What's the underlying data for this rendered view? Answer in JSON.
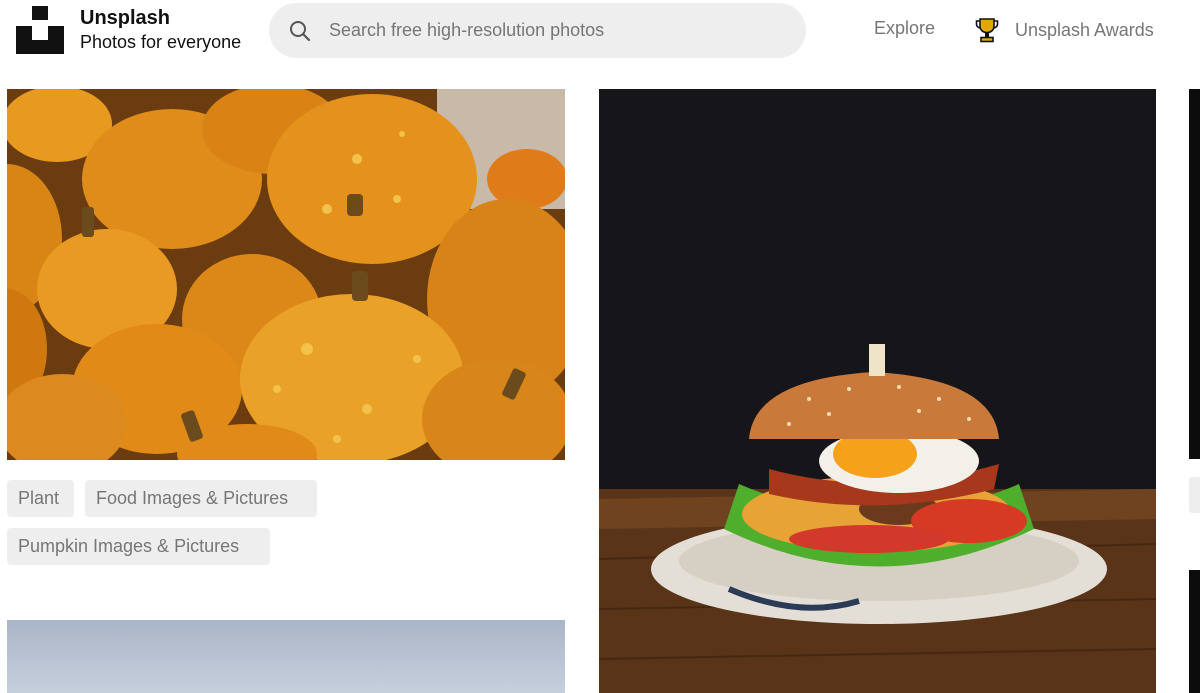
{
  "brand": {
    "name": "Unsplash",
    "tagline": "Photos for everyone"
  },
  "search": {
    "placeholder": "Search free high-resolution photos",
    "icon": "search-icon"
  },
  "nav": {
    "explore": "Explore",
    "awards": "Unsplash Awards",
    "awards_icon": "trophy-icon"
  },
  "photos": [
    {
      "subject": "pumpkins",
      "tags": [
        "Plant",
        "Food Images & Pictures",
        "Pumpkin Images & Pictures"
      ]
    },
    {
      "subject": "burger"
    },
    {
      "subject": "sky"
    }
  ],
  "colors": {
    "tag_bg": "#eeeeee",
    "tag_text": "#767676",
    "search_bg": "#eeeeee",
    "trophy": "#e0a800"
  }
}
